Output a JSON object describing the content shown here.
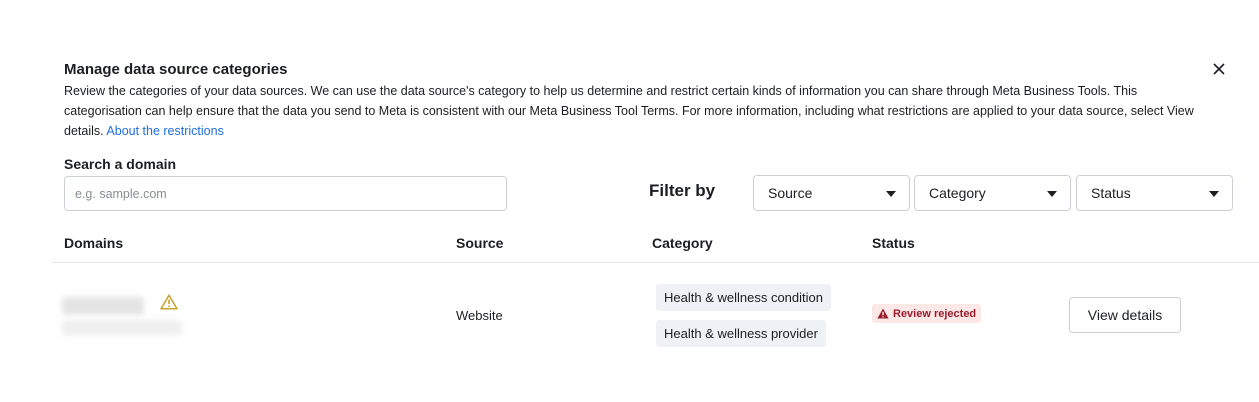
{
  "dialog": {
    "title": "Manage data source categories",
    "description": "Review the categories of your data sources. We can use the data source's category to help us determine and restrict certain kinds of information you can share through Meta Business Tools. This categorisation can help ensure that the data you send to Meta is consistent with our Meta Business Tool Terms. For more information, including what restrictions are applied to your data source, select View details.",
    "description_link": "About the restrictions",
    "close_icon": "close-icon"
  },
  "search": {
    "label": "Search a domain",
    "placeholder": "e.g. sample.com",
    "value": ""
  },
  "filters": {
    "label": "Filter by",
    "source": "Source",
    "category": "Category",
    "status": "Status"
  },
  "table": {
    "headers": {
      "domains": "Domains",
      "source": "Source",
      "category": "Category",
      "status": "Status"
    },
    "rows": [
      {
        "domain": "",
        "domain_icon": "warning-icon",
        "source": "Website",
        "categories": [
          "Health & wellness condition",
          "Health & wellness provider"
        ],
        "status": "Review rejected",
        "status_icon": "alert-icon",
        "action": "View details"
      }
    ]
  },
  "colors": {
    "link": "#216fdb",
    "status_rejected_text": "#9b1c2c",
    "status_rejected_bg": "#fde8e8",
    "warning": "#c7a22d",
    "tag_bg": "#eef1f5"
  }
}
